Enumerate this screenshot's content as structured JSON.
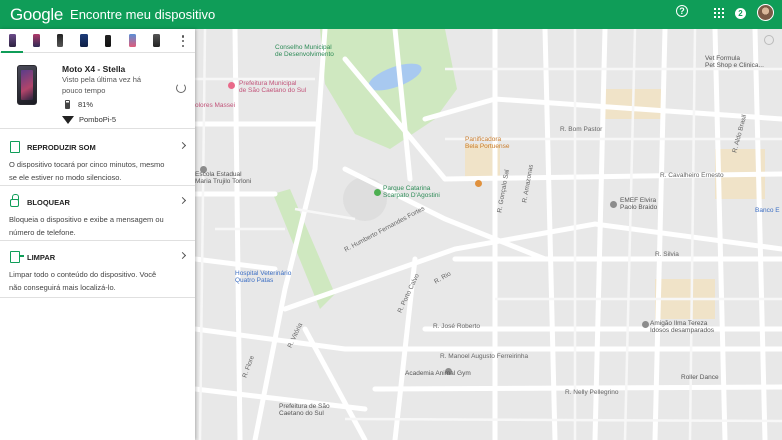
{
  "header": {
    "logo_text": "Google",
    "app_title": "Encontre meu dispositivo",
    "help_label": "?",
    "notification_count": "2"
  },
  "devices": {
    "thumbnail_count": 7,
    "selected_index": 0
  },
  "device": {
    "name": "Moto X4 - Stella",
    "last_seen": "Visto pela última vez há pouco tempo",
    "battery": "81%",
    "battery_level": 0.81,
    "network": "PomboPi-5"
  },
  "actions": {
    "play_sound": {
      "title": "REPRODUZIR SOM",
      "description": "O dispositivo tocará por cinco minutos, mesmo se ele estiver no modo silencioso."
    },
    "lock": {
      "title": "BLOQUEAR",
      "description": "Bloqueia o dispositivo e exibe a mensagem ou número de telefone."
    },
    "erase": {
      "title": "LIMPAR",
      "description": "Limpar todo o conteúdo do dispositivo. Você não conseguirá mais localizá-lo."
    }
  },
  "map": {
    "labels": {
      "l1": "Conselho Municipal",
      "l2": "de Desenvolvimento",
      "l3": "Prefeitura Municipal",
      "l4": "de São Caetano do Sul",
      "l5": "olores Massei",
      "l6": "Escola Estadual",
      "l7": "Maria Trujilo Torloni",
      "l8": "Panificadora",
      "l9": "Bela Portuense",
      "l10": "Parque Catarina",
      "l11": "Scarpato D'Agostini",
      "l12": "Vet Formula",
      "l13": "Pet Shop e Clinica...",
      "l14": "EMEF Elvira",
      "l15": "Paolo Braido",
      "l16": "Banco E",
      "l17": "Hospital Veterinário",
      "l18": "Quatro Patas",
      "l19": "Amigão Ilma Tereza",
      "l20": "Idosos desamparados",
      "l21": "Academia Animal Gym",
      "l22": "Roller Dance",
      "l23": "Prefeitura de São",
      "l24": "Caetano do Sul",
      "s1": "R. Bom Pastor",
      "s2": "R. Cavalheiro Ernesto",
      "s3": "R. Silvia",
      "s4": "R. Manoel Augusto Ferreirinha",
      "s5": "R. Nelly Pellegrino",
      "s6": "R. José Roberto",
      "s7": "R. Humberto Fernandes Fortes",
      "s8": "R. Amazonas",
      "s9": "R. Aldo Brasil",
      "s10": "R. Vitória",
      "s11": "R. Porto Calvo",
      "s12": "R. Gonçalo Sal",
      "s13": "R. Rio",
      "s14": "R. Flore"
    }
  }
}
